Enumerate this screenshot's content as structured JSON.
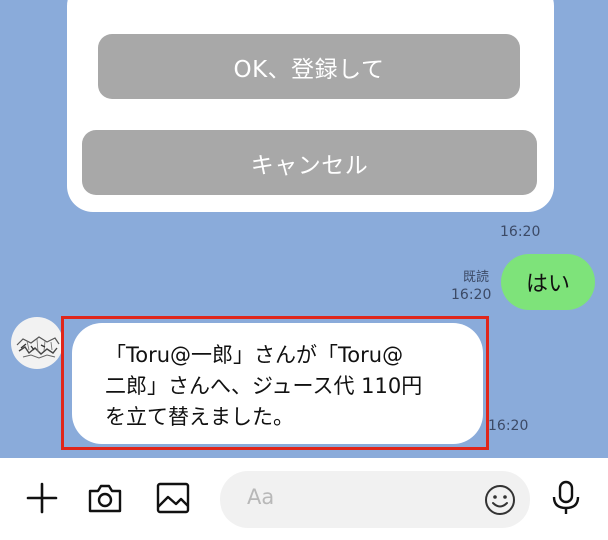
{
  "card": {
    "ok_label": "OK、登録して",
    "cancel_label": "キャンセル"
  },
  "messages": {
    "card_time": "16:20",
    "me": {
      "text": "はい",
      "read_label": "既読",
      "time": "16:20"
    },
    "other": {
      "text_line1": "「Toru@一郎」さんが「Toru@",
      "text_line2": "二郎」さんへ、ジュース代 110円",
      "text_line3": "を立て替えました。",
      "time": "16:20"
    }
  },
  "input_bar": {
    "placeholder": "Aa",
    "icons": [
      "plus-icon",
      "camera-icon",
      "image-icon",
      "emoji-icon",
      "microphone-icon"
    ]
  },
  "colors": {
    "chat_background": "#8aabda",
    "my_bubble": "#7ee37a",
    "highlight_border": "#e0261b",
    "button_gray": "#a8a8a8"
  }
}
